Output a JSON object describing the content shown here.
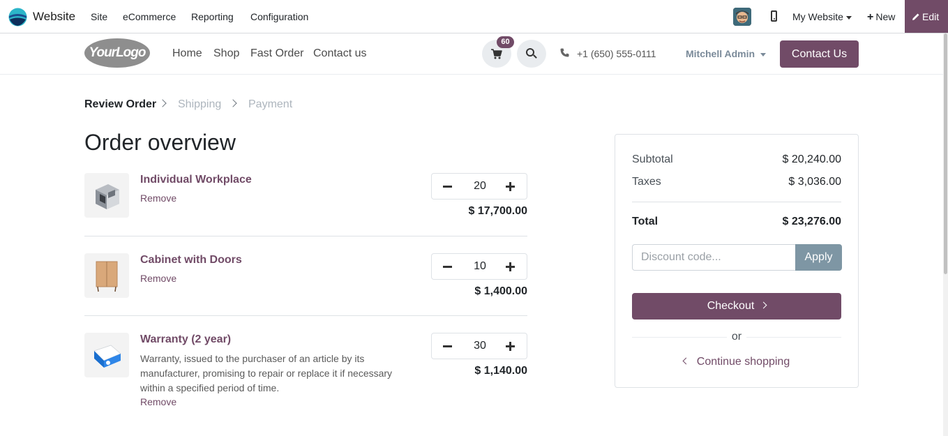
{
  "admin_bar": {
    "app_title": "Website",
    "menus": [
      "Site",
      "eCommerce",
      "Reporting",
      "Configuration"
    ],
    "my_website": "My Website",
    "new_label": "New",
    "edit_label": "Edit"
  },
  "header": {
    "logo_text": "YourLogo",
    "nav": [
      "Home",
      "Shop",
      "Fast Order",
      "Contact us"
    ],
    "cart_count": "60",
    "phone": "+1 (650) 555-0111",
    "user": "Mitchell Admin",
    "contact_button": "Contact Us"
  },
  "steps": [
    {
      "label": "Review Order",
      "state": "active"
    },
    {
      "label": "Shipping",
      "state": "inactive"
    },
    {
      "label": "Payment",
      "state": "inactive"
    }
  ],
  "page_title": "Order overview",
  "lines": [
    {
      "name": "Individual Workplace",
      "description": "",
      "remove": "Remove",
      "qty": "20",
      "price": "$ 17,700.00",
      "thumb_icon": "workplace-cube"
    },
    {
      "name": "Cabinet with Doors",
      "description": "",
      "remove": "Remove",
      "qty": "10",
      "price": "$ 1,400.00",
      "thumb_icon": "wooden-cabinet"
    },
    {
      "name": "Warranty (2 year)",
      "description": "Warranty, issued to the purchaser of an article by its manufacturer, promising to repair or replace it if necessary within a specified period of time.",
      "remove": "Remove",
      "qty": "30",
      "price": "$ 1,140.00",
      "thumb_icon": "warranty-box"
    }
  ],
  "summary": {
    "subtotal_label": "Subtotal",
    "subtotal_value": "$ 20,240.00",
    "taxes_label": "Taxes",
    "taxes_value": "$ 3,036.00",
    "total_label": "Total",
    "total_value": "$ 23,276.00",
    "discount_placeholder": "Discount code...",
    "apply_label": "Apply",
    "checkout_label": "Checkout",
    "or_label": "or",
    "continue_label": "Continue shopping"
  },
  "colors": {
    "brand": "#714b67",
    "apply": "#7e96a4"
  }
}
